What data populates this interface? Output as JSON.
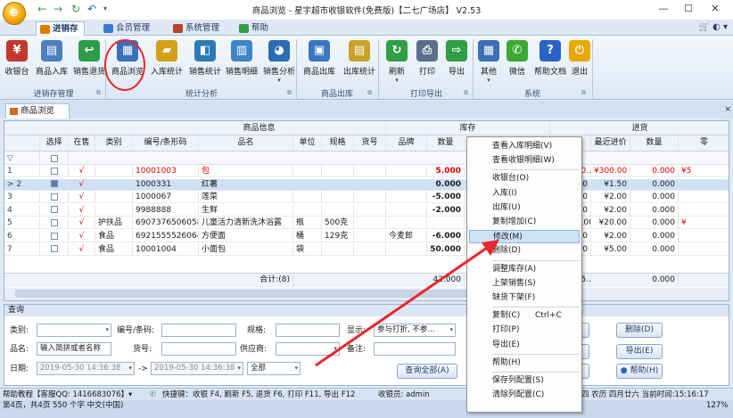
{
  "window": {
    "title": "商品浏览 - 星宇超市收银软件(免费版)【二七广场店】 V2.53",
    "logo": "app-logo",
    "min": "—",
    "max": "☐",
    "close": "✕"
  },
  "quick_access": [
    "←",
    "→",
    "↻",
    "↶",
    "▾"
  ],
  "tabs": [
    {
      "label": "进销存",
      "icon_color": "#e07b00"
    },
    {
      "label": "会员管理",
      "icon_color": "#3a7bd5"
    },
    {
      "label": "系统管理",
      "icon_color": "#b5452a"
    },
    {
      "label": "帮助",
      "icon_color": "#2f9e44"
    }
  ],
  "tabrow_right": "🛒 ◐ ▾",
  "ribbon": {
    "buttons": [
      {
        "label": "收银台",
        "icon": "cash-register-icon",
        "color": "#c0392b",
        "glyph": "¥",
        "dd": false
      },
      {
        "label": "商品入库",
        "icon": "stock-in-icon",
        "color": "#4a7fc1",
        "glyph": "▤",
        "dd": false
      },
      {
        "label": "销售退货",
        "icon": "return-icon",
        "color": "#2e9d4a",
        "glyph": "↩",
        "dd": false
      },
      {
        "label": "商品浏览",
        "icon": "browse-icon",
        "color": "#3b6fb8",
        "glyph": "▦",
        "dd": false
      },
      {
        "label": "入库统计",
        "icon": "stock-stats-icon",
        "color": "#d4a017",
        "glyph": "▰",
        "dd": false
      },
      {
        "label": "销售统计",
        "icon": "sales-stats-icon",
        "color": "#2b7bb9",
        "glyph": "◧",
        "dd": false
      },
      {
        "label": "销售明细",
        "icon": "sales-detail-icon",
        "color": "#3d86c8",
        "glyph": "▥",
        "dd": false
      },
      {
        "label": "销售分析",
        "icon": "analysis-icon",
        "color": "#2a6db5",
        "glyph": "◕",
        "dd": true
      },
      {
        "label": "商品出库",
        "icon": "stock-out-icon",
        "color": "#3a78c2",
        "glyph": "▣",
        "dd": false
      },
      {
        "label": "出库统计",
        "icon": "out-stats-icon",
        "color": "#c9a227",
        "glyph": "▤",
        "dd": false
      },
      {
        "label": "刷新",
        "icon": "refresh-icon",
        "color": "#2f9e44",
        "glyph": "↻",
        "dd": true
      },
      {
        "label": "打印",
        "icon": "print-icon",
        "color": "#5a6f8c",
        "glyph": "⎙",
        "dd": false
      },
      {
        "label": "导出",
        "icon": "export-icon",
        "color": "#2f9e44",
        "glyph": "⇨",
        "dd": false
      },
      {
        "label": "其他",
        "icon": "other-icon",
        "color": "#3b6fb8",
        "glyph": "▦",
        "dd": true
      },
      {
        "label": "微信",
        "icon": "wechat-icon",
        "color": "#3aa935",
        "glyph": "✆",
        "dd": false
      },
      {
        "label": "帮助文档",
        "icon": "help-icon",
        "color": "#2a62c7",
        "glyph": "?",
        "dd": false
      },
      {
        "label": "退出",
        "icon": "exit-icon",
        "color": "#e9a800",
        "glyph": "⏻",
        "dd": false
      }
    ],
    "groups": [
      "进销存管理",
      "统计分析",
      "商品出库",
      "打印导出",
      "系统"
    ]
  },
  "doc_tab": {
    "label": "商品浏览",
    "close": "×"
  },
  "grid": {
    "group_headers": [
      "商品信息",
      "库存",
      "进货"
    ],
    "columns": [
      "选择",
      "在售",
      "类别",
      "编号/条形码",
      "品名",
      "单位",
      "规格",
      "货号",
      "品牌",
      "数量",
      "成",
      "金额",
      "最近进价",
      "数量",
      "零"
    ],
    "rows": [
      {
        "n": "1",
        "sel": false,
        "on": "√",
        "cat": "",
        "code": "10001003",
        "name": "包",
        "unit": "",
        "spec": "",
        "no": "",
        "brand": "",
        "qty": "5.000",
        "cost": "¥",
        "amt": "¥16,500...",
        "last": "¥300.00",
        "qty2": "0.000",
        "ret": "¥5",
        "red": true
      },
      {
        "n": "2",
        "sel": true,
        "on": "√",
        "cat": "",
        "code": "1000331",
        "name": "红薯",
        "unit": "",
        "spec": "",
        "no": "",
        "brand": "",
        "qty": "0.000",
        "cost": "",
        "amt": "¥15.00",
        "last": "¥1.50",
        "qty2": "0.000",
        "ret": "",
        "red": false,
        "selected": true
      },
      {
        "n": "3",
        "sel": false,
        "on": "√",
        "cat": "",
        "code": "1000067",
        "name": "莲菜",
        "unit": "",
        "spec": "",
        "no": "",
        "brand": "",
        "qty": "-5.000",
        "cost": "",
        "amt": "¥20.00",
        "last": "¥2.00",
        "qty2": "0.000",
        "ret": "",
        "red": false
      },
      {
        "n": "4",
        "sel": false,
        "on": "√",
        "cat": "",
        "code": "9988888",
        "name": "生鲜",
        "unit": "",
        "spec": "",
        "no": "",
        "brand": "",
        "qty": "-2.000",
        "cost": "",
        "amt": "¥20.00",
        "last": "¥2.00",
        "qty2": "0.000",
        "ret": "",
        "red": false
      },
      {
        "n": "5",
        "sel": false,
        "on": "√",
        "cat": "护扶品",
        "code": "6907376506058",
        "name": "儿童活力清新洗沐浴露",
        "unit": "瓶",
        "spec": "500克",
        "no": "",
        "brand": "",
        "qty": "",
        "cost": "",
        "amt": "¥1,900.00",
        "last": "¥20.00",
        "qty2": "0.000",
        "ret": "¥",
        "red": false
      },
      {
        "n": "6",
        "sel": false,
        "on": "√",
        "cat": "食品",
        "code": "6921555526064",
        "name": "方便面",
        "unit": "桶",
        "spec": "129克",
        "no": "",
        "brand": "今麦郎",
        "qty": "-6.000",
        "cost": "",
        "amt": "¥398.00",
        "last": "¥2.00",
        "qty2": "0.000",
        "ret": "",
        "red": false
      },
      {
        "n": "7",
        "sel": false,
        "on": "√",
        "cat": "食品",
        "code": "10001004",
        "name": "小面包",
        "unit": "袋",
        "spec": "",
        "no": "",
        "brand": "",
        "qty": "50.000",
        "cost": "",
        "amt": "¥250.00",
        "last": "¥5.00",
        "qty2": "0.000",
        "ret": "",
        "red": false
      }
    ],
    "sum_label": "合计:(8)",
    "sum_qty": "42.000",
    "sum_amt": "¥19,385...",
    "sum_qty2": "0.000",
    "filter_icon": "▽"
  },
  "query": {
    "title": "查询",
    "labels": {
      "category": "类别:",
      "code": "编号/条码:",
      "spec": "规格:",
      "show": "显示:",
      "name": "品名:",
      "item_no": "货号:",
      "supplier": "供应商:",
      "note": "备注:",
      "date": "日期:"
    },
    "name_value": "输入简拼或者名称",
    "show_value": "参与打折, 不参...",
    "date_from": "2019-05-30 14:36:38",
    "date_sep": "->",
    "date_to": "2019-05-30 14:36:38",
    "date_range": "全部",
    "buttons": {
      "query_all": "查询全部(A)",
      "delete": "删除(D)",
      "export": "导出(E)",
      "help": "帮助(H)"
    }
  },
  "status": {
    "tutorial": "帮助教程【客服QQ: 1416683076】▾",
    "shortcuts": "快捷键：收银 F4, 刷新 F5, 退货 F6, 打印 F11, 导出 F12",
    "cashier": "收银员: admin",
    "datetime": "四 农历 四月廿六 当前时间:15:16:17",
    "pager": "第4页，共4页   550 个字    中文(中国)",
    "zoom": "127%"
  },
  "context_menu": {
    "items": [
      {
        "label": "查看入库明细(V)",
        "sep_after": false
      },
      {
        "label": "查看收银明细(W)",
        "sep_after": true
      },
      {
        "label": "收银台(O)",
        "sep_after": false
      },
      {
        "label": "入库(I)",
        "sep_after": false
      },
      {
        "label": "出库(U)",
        "sep_after": false
      },
      {
        "label": "复制增加(C)",
        "sep_after": false
      },
      {
        "label": "修改(M)",
        "sep_after": false,
        "highlighted": true
      },
      {
        "label": "删除(D)",
        "sep_after": true
      },
      {
        "label": "调整库存(A)",
        "sep_after": false
      },
      {
        "label": "上架销售(S)",
        "sep_after": false
      },
      {
        "label": "缺货下架(F)",
        "sep_after": true
      },
      {
        "label": "复制(C)",
        "shortcut": "Ctrl+C",
        "sep_after": false
      },
      {
        "label": "打印(P)",
        "sep_after": false
      },
      {
        "label": "导出(E)",
        "sep_after": true
      },
      {
        "label": "帮助(H)",
        "sep_after": true
      },
      {
        "label": "保存列配置(S)",
        "sep_after": false
      },
      {
        "label": "清除列配置(C)",
        "sep_after": false
      }
    ]
  },
  "annotation_color": "#e8262c"
}
